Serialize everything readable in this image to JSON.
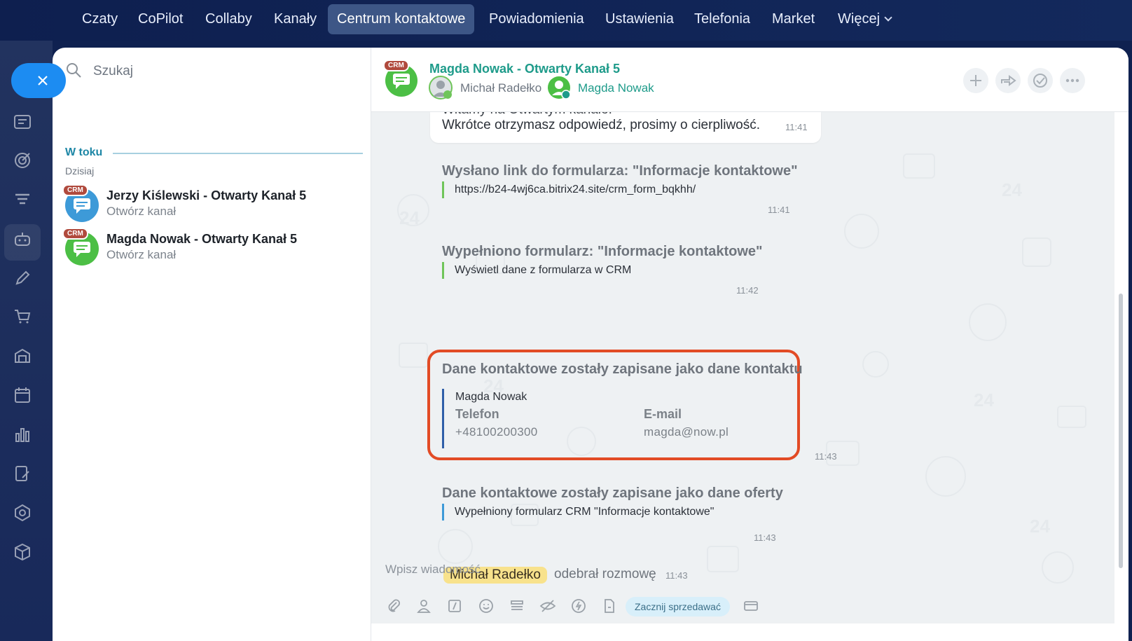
{
  "topnav": {
    "items": [
      "Czaty",
      "CoPilot",
      "Collaby",
      "Kanały",
      "Centrum kontaktowe",
      "Powiadomienia",
      "Ustawienia",
      "Telefonia",
      "Market",
      "Więcej"
    ],
    "active": "Centrum kontaktowe"
  },
  "rail": {
    "icons": [
      "newspaper-icon",
      "target-icon",
      "funnel-icon",
      "robot-icon",
      "pencil-icon",
      "cart-icon",
      "warehouse-icon",
      "calendar-icon",
      "bar-chart-icon",
      "document-edit-icon",
      "hexagon-icon",
      "cube-icon"
    ]
  },
  "sidebar": {
    "search_placeholder": "Szukaj",
    "section_title": "W toku",
    "section_sub": "Dzisiaj",
    "chats": [
      {
        "title": "Jerzy Kiślewski - Otwarty Kanał 5",
        "subtitle": "Otwórz kanał",
        "badge": "CRM",
        "color": "#3d9ad8"
      },
      {
        "title": "Magda Nowak - Otwarty Kanał 5",
        "subtitle": "Otwórz kanał",
        "badge": "CRM",
        "color": "#4cbf45"
      }
    ]
  },
  "chat": {
    "badge": "CRM",
    "title": "Magda Nowak - Otwarty Kanał 5",
    "participant_operator": "Michał Radełko",
    "participant_client": "Magda Nowak",
    "messages": {
      "top_cut_text": "Witamy na Otwartym kanale!",
      "top_text": "Wkrótce otrzymasz odpowiedź, prosimy o cierpliwość.",
      "top_time": "11:41",
      "link_title": "Wysłano link do formularza: \"Informacje kontaktowe\"",
      "link_url": "https://b24-4wj6ca.bitrix24.site/crm_form_bqkhh/",
      "link_time": "11:41",
      "filled_title": "Wypełniono formularz: \"Informacje kontaktowe\"",
      "filled_link": "Wyświetl dane z formularza w CRM",
      "filled_time": "11:42",
      "contact_title": "Dane kontaktowe zostały zapisane jako dane kontaktu",
      "contact_name": "Magda Nowak",
      "phone_label": "Telefon",
      "phone_value": "+48100200300",
      "email_label": "E-mail",
      "email_value": "magda@now.pl",
      "contact_time": "11:43",
      "offer_title": "Dane kontaktowe zostały zapisane jako dane oferty",
      "offer_text": "Wypełniony formularz CRM \"Informacje kontaktowe\"",
      "offer_time": "11:43",
      "operator_name": "Michał Radełko",
      "operator_action": "odebrał rozmowę",
      "operator_time": "11:43"
    },
    "composer": {
      "placeholder": "Wpisz wiadomość",
      "sell_label": "Zacznij sprzedawać"
    }
  },
  "colors": {
    "accent": "#1c8cf2",
    "highlight": "#e24b25",
    "teal": "#1e9b8a",
    "nav_bg": "#0f2150"
  }
}
